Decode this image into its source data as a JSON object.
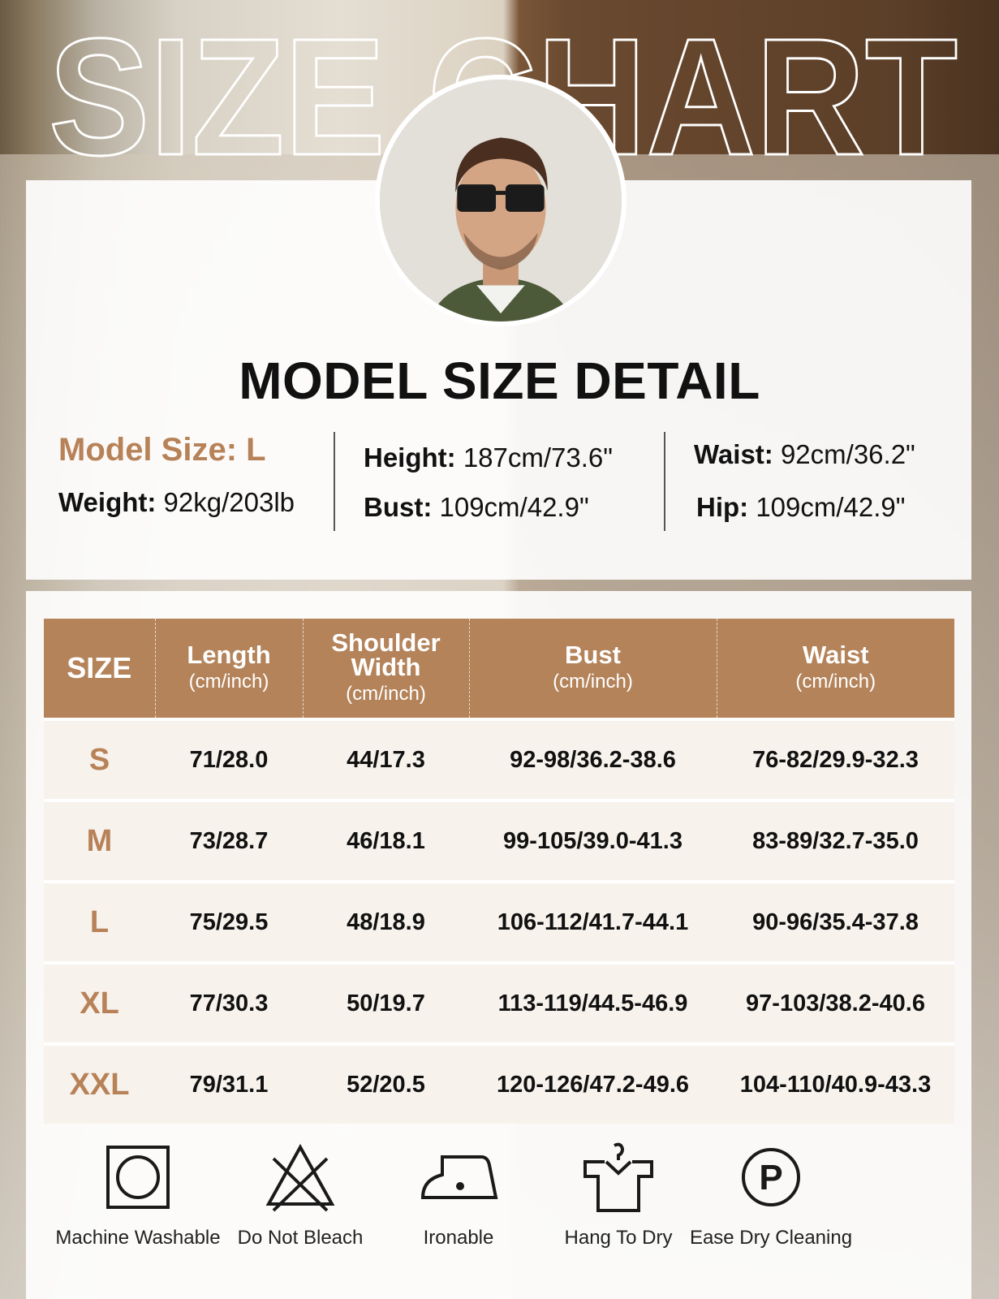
{
  "header": {
    "title": "SIZE CHART"
  },
  "model": {
    "heading": "MODEL SIZE DETAIL",
    "size_label": "Model Size: L",
    "weight_key": "Weight:",
    "weight_val": "92kg/203lb",
    "height_key": "Height:",
    "height_val": "187cm/73.6\"",
    "bust_key": "Bust:",
    "bust_val": "109cm/42.9\"",
    "waist_key": "Waist:",
    "waist_val": "92cm/36.2\"",
    "hip_key": "Hip:",
    "hip_val": "109cm/42.9\""
  },
  "table": {
    "headers": [
      {
        "main": "SIZE",
        "sub": ""
      },
      {
        "main": "Length",
        "sub": "(cm/inch)"
      },
      {
        "main": "Shoulder Width",
        "sub": "(cm/inch)"
      },
      {
        "main": "Bust",
        "sub": "(cm/inch)"
      },
      {
        "main": "Waist",
        "sub": "(cm/inch)"
      }
    ],
    "rows": [
      [
        "S",
        "71/28.0",
        "44/17.3",
        "92-98/36.2-38.6",
        "76-82/29.9-32.3"
      ],
      [
        "M",
        "73/28.7",
        "46/18.1",
        "99-105/39.0-41.3",
        "83-89/32.7-35.0"
      ],
      [
        "L",
        "75/29.5",
        "48/18.9",
        "106-112/41.7-44.1",
        "90-96/35.4-37.8"
      ],
      [
        "XL",
        "77/30.3",
        "50/19.7",
        "113-119/44.5-46.9",
        "97-103/38.2-40.6"
      ],
      [
        "XXL",
        "79/31.1",
        "52/20.5",
        "120-126/47.2-49.6",
        "104-110/40.9-43.3"
      ]
    ]
  },
  "care": [
    {
      "icon": "machine-wash-icon",
      "label": "Machine Washable"
    },
    {
      "icon": "no-bleach-icon",
      "label": "Do Not Bleach"
    },
    {
      "icon": "iron-icon",
      "label": "Ironable"
    },
    {
      "icon": "hang-dry-icon",
      "label": "Hang To Dry"
    },
    {
      "icon": "dry-clean-icon",
      "label": "Ease Dry Cleaning"
    }
  ],
  "colors": {
    "accent": "#b4835a",
    "accent_text": "#b88258",
    "row_bg": "#f7f2ec"
  }
}
